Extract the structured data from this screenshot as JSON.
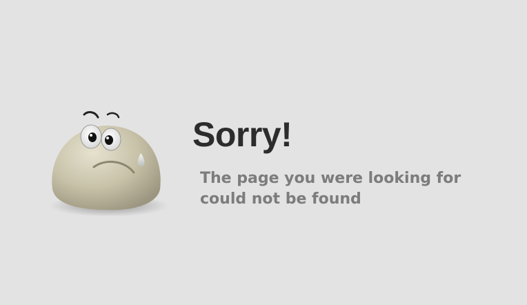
{
  "error_page": {
    "heading": "Sorry!",
    "message_line_1": "The page you were looking for",
    "message_line_2": "could not be found",
    "mascot_icon": "sad-face-icon"
  },
  "colors": {
    "background": "#e3e3e3",
    "heading": "#2c2c2c",
    "message": "#7c7c7c",
    "mascot_body": "#c9c4ad"
  }
}
